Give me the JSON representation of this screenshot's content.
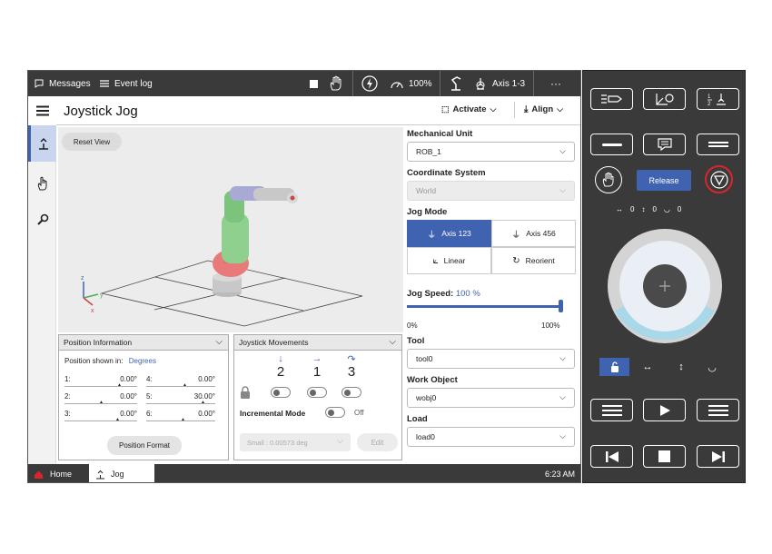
{
  "topbar": {
    "messages_label": "Messages",
    "event_log_label": "Event log",
    "speed_label": "100%",
    "axis_label": "Axis 1-3",
    "more_label": "···"
  },
  "sidebar": {
    "items": [
      {
        "name": "jog",
        "icon": "jog-icon"
      },
      {
        "name": "hand",
        "icon": "hand-pointer-icon"
      },
      {
        "name": "tool",
        "icon": "wrench-icon"
      }
    ]
  },
  "header": {
    "title": "Joystick Jog",
    "activate_label": "Activate",
    "align_label": "Align"
  },
  "viewport": {
    "reset_view_label": "Reset View",
    "axis_labels": {
      "z": "z",
      "x": "x",
      "y": "y"
    }
  },
  "position_info": {
    "title": "Position Information",
    "shown_in_label": "Position shown in:",
    "shown_in_value": "Degrees",
    "rows": [
      {
        "left_label": "1:",
        "left_value": "0.00°",
        "right_label": "4:",
        "right_value": "0.00°"
      },
      {
        "left_label": "2:",
        "left_value": "0.00°",
        "right_label": "5:",
        "right_value": "30.00°"
      },
      {
        "left_label": "3:",
        "left_value": "0.00°",
        "right_label": "6:",
        "right_value": "0.00°"
      }
    ],
    "format_button": "Position Format"
  },
  "joystick_movements": {
    "title": "Joystick Movements",
    "axes": [
      "2",
      "1",
      "3"
    ],
    "incremental_label": "Incremental Mode",
    "incremental_state": "Off",
    "increment_value": "Small : 0.00573 deg",
    "edit_label": "Edit"
  },
  "settings": {
    "mechanical_unit_label": "Mechanical Unit",
    "mechanical_unit_value": "ROB_1",
    "coord_system_label": "Coordinate System",
    "coord_system_value": "World",
    "jog_mode_label": "Jog Mode",
    "jog_modes": [
      {
        "label": "Axis 123",
        "active": true
      },
      {
        "label": "Axis 456",
        "active": false
      },
      {
        "label": "Linear",
        "active": false
      },
      {
        "label": "Reorient",
        "active": false
      }
    ],
    "jog_speed_label": "Jog Speed:",
    "jog_speed_value": "100 %",
    "jog_speed_fraction": 1.0,
    "speed_min": "0%",
    "speed_max": "100%",
    "tool_label": "Tool",
    "tool_value": "tool0",
    "work_object_label": "Work Object",
    "work_object_value": "wobj0",
    "load_label": "Load",
    "load_value": "load0"
  },
  "bottombar": {
    "home_label": "Home",
    "jog_label": "Jog",
    "time": "6:23 AM"
  },
  "flexpendant": {
    "release_label": "Release",
    "readout": [
      "0",
      "0",
      "0"
    ],
    "accent": "#3f63b0",
    "stop_color": "#d9262a"
  }
}
